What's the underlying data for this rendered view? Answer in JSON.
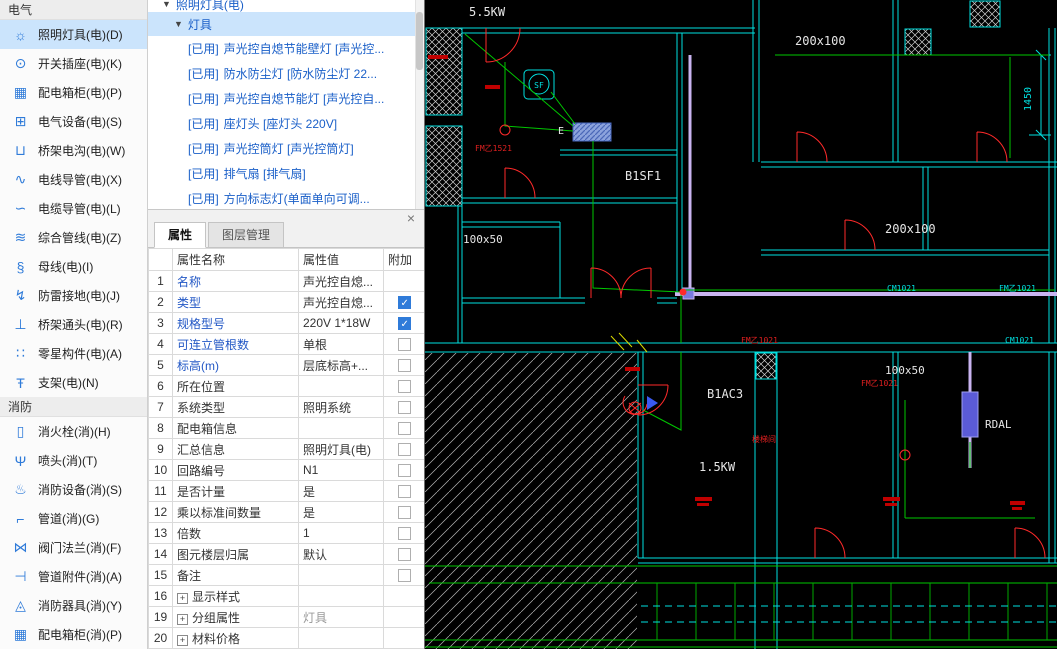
{
  "sidebar": {
    "sections": [
      {
        "header": "电气",
        "items": [
          {
            "label": "照明灯具(电)(D)",
            "icon": "lamp-icon",
            "glyph": "☼",
            "selected": true
          },
          {
            "label": "开关插座(电)(K)",
            "icon": "switch-socket-icon",
            "glyph": "⊙"
          },
          {
            "label": "配电箱柜(电)(P)",
            "icon": "distribution-box-icon",
            "glyph": "▦"
          },
          {
            "label": "电气设备(电)(S)",
            "icon": "electric-device-icon",
            "glyph": "⊞"
          },
          {
            "label": "桥架电沟(电)(W)",
            "icon": "cable-tray-icon",
            "glyph": "⊔"
          },
          {
            "label": "电线导管(电)(X)",
            "icon": "wire-conduit-icon",
            "glyph": "∿"
          },
          {
            "label": "电缆导管(电)(L)",
            "icon": "cable-conduit-icon",
            "glyph": "∽"
          },
          {
            "label": "综合管线(电)(Z)",
            "icon": "combined-pipeline-icon",
            "glyph": "≋"
          },
          {
            "label": "母线(电)(I)",
            "icon": "busbar-icon",
            "glyph": "§"
          },
          {
            "label": "防雷接地(电)(J)",
            "icon": "lightning-ground-icon",
            "glyph": "↯"
          },
          {
            "label": "桥架通头(电)(R)",
            "icon": "tray-fitting-icon",
            "glyph": "⊥"
          },
          {
            "label": "零星构件(电)(A)",
            "icon": "misc-component-icon",
            "glyph": "∷"
          },
          {
            "label": "支架(电)(N)",
            "icon": "support-bracket-icon",
            "glyph": "Ŧ"
          }
        ]
      },
      {
        "header": "消防",
        "items": [
          {
            "label": "消火栓(消)(H)",
            "icon": "fire-hydrant-icon",
            "glyph": "▯"
          },
          {
            "label": "喷头(消)(T)",
            "icon": "sprinkler-icon",
            "glyph": "Ψ"
          },
          {
            "label": "消防设备(消)(S)",
            "icon": "fire-device-icon",
            "glyph": "♨"
          },
          {
            "label": "管道(消)(G)",
            "icon": "pipe-icon",
            "glyph": "⌐"
          },
          {
            "label": "阀门法兰(消)(F)",
            "icon": "valve-flange-icon",
            "glyph": "⋈"
          },
          {
            "label": "管道附件(消)(A)",
            "icon": "pipe-fitting-icon",
            "glyph": "⊣"
          },
          {
            "label": "消防器具(消)(Y)",
            "icon": "fire-equipment-icon",
            "glyph": "◬"
          },
          {
            "label": "配电箱柜(消)(P)",
            "icon": "distribution-box-fire-icon",
            "glyph": "▦"
          }
        ]
      }
    ]
  },
  "tree": {
    "parent": "照明灯具(电)",
    "group": "灯具",
    "items": [
      {
        "tag": "[已用]",
        "name": "声光控自熄节能壁灯 [声光控..."
      },
      {
        "tag": "[已用]",
        "name": "防水防尘灯 [防水防尘灯 22..."
      },
      {
        "tag": "[已用]",
        "name": "声光控自熄节能灯 [声光控自..."
      },
      {
        "tag": "[已用]",
        "name": "座灯头 [座灯头 220V]"
      },
      {
        "tag": "[已用]",
        "name": "声光控筒灯 [声光控筒灯]"
      },
      {
        "tag": "[已用]",
        "name": "排气扇 [排气扇]"
      },
      {
        "tag": "[已用]",
        "name": "方向标志灯(单面单向可调..."
      }
    ]
  },
  "properties_panel": {
    "close_label": "×",
    "tabs": [
      {
        "label": "属性",
        "active": true
      },
      {
        "label": "图层管理",
        "active": false
      }
    ],
    "columns": {
      "name": "属性名称",
      "value": "属性值",
      "extra": "附加"
    },
    "rows": [
      {
        "num": "1",
        "name": "名称",
        "value": "声光控自熄...",
        "checkbox": "none",
        "link": true
      },
      {
        "num": "2",
        "name": "类型",
        "value": "声光控自熄...",
        "checkbox": "checked",
        "link": true
      },
      {
        "num": "3",
        "name": "规格型号",
        "value": "220V 1*18W",
        "checkbox": "checked",
        "link": true
      },
      {
        "num": "4",
        "name": "可连立管根数",
        "value": "单根",
        "checkbox": "unchecked",
        "link": true
      },
      {
        "num": "5",
        "name": "标高(m)",
        "value": "层底标高+...",
        "checkbox": "unchecked",
        "link": true
      },
      {
        "num": "6",
        "name": "所在位置",
        "value": "",
        "checkbox": "unchecked"
      },
      {
        "num": "7",
        "name": "系统类型",
        "value": "照明系统",
        "checkbox": "unchecked"
      },
      {
        "num": "8",
        "name": "配电箱信息",
        "value": "",
        "checkbox": "unchecked"
      },
      {
        "num": "9",
        "name": "汇总信息",
        "value": "照明灯具(电)",
        "checkbox": "unchecked"
      },
      {
        "num": "10",
        "name": "回路编号",
        "value": "N1",
        "checkbox": "unchecked"
      },
      {
        "num": "11",
        "name": "是否计量",
        "value": "是",
        "checkbox": "unchecked"
      },
      {
        "num": "12",
        "name": "乘以标准间数量",
        "value": "是",
        "checkbox": "unchecked"
      },
      {
        "num": "13",
        "name": "倍数",
        "value": "1",
        "checkbox": "unchecked"
      },
      {
        "num": "14",
        "name": "图元楼层归属",
        "value": "默认",
        "checkbox": "unchecked"
      },
      {
        "num": "15",
        "name": "备注",
        "value": "",
        "checkbox": "unchecked"
      },
      {
        "num": "16",
        "name": "显示样式",
        "value": "",
        "checkbox": "none",
        "expandable": true
      },
      {
        "num": "19",
        "name": "分组属性",
        "value": "灯具",
        "checkbox": "none",
        "expandable": true,
        "muted": true
      },
      {
        "num": "20",
        "name": "材料价格",
        "value": "",
        "checkbox": "none",
        "expandable": true
      }
    ]
  },
  "drawing": {
    "labels": {
      "kw_top": "5.5KW",
      "size_top": "200x100",
      "dim_right": "1450",
      "sf_symbol": "SF",
      "e_mark": "E",
      "panel_b1sf1": "B1SF1",
      "fm_1521": "FM乙1521",
      "size_left": "100x50",
      "size_mid": "200x100",
      "cm_1021_a": "CM1021",
      "fm_1021_a": "FM乙1021",
      "fm_1021_b": "FM乙1021",
      "cm_1021_b": "CM1021",
      "size_low": "100x50",
      "fm_1021_c": "FM乙1021",
      "panel_b1ac3": "B1AC3",
      "panel_rdal": "RDAL",
      "kw_low": "1.5KW",
      "stairwell": "楼梯间"
    }
  }
}
